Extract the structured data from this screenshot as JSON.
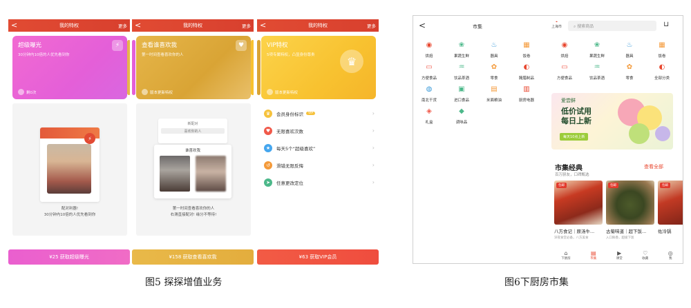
{
  "fig5": {
    "caption": "图5 探探增值业务",
    "screens": [
      {
        "back": "<",
        "title": "我的特权",
        "more": "更多",
        "card_title": "超级曝光",
        "card_sub": "30分钟内10倍的人优先看到你",
        "card_foot": "剩0次",
        "caption_line1": "配对利器!",
        "caption_line2": "30分钟内10倍的人优先看到你",
        "cta": "¥25 获取超级曝光"
      },
      {
        "back": "<",
        "title": "我的特权",
        "more": "更多",
        "card_title": "查看谁喜欢我",
        "card_sub": "第一时间查看喜欢你的人",
        "card_foot": "版本更新特权",
        "mini_title": "新配对",
        "mini_sub": "喜欢你的人",
        "likes_title": "谁喜欢我",
        "caption_line1": "第一时间查看喜欢你的人",
        "caption_line2": "右滑直接配对! 缘分不等待!",
        "cta": "¥158 获取查看喜欢我"
      },
      {
        "back": "<",
        "title": "我的特权",
        "more": "更多",
        "card_title": "VIP特权",
        "card_sub": "5项专属特权，凸显身份尊贵",
        "card_foot": "版本更新特权",
        "perks": [
          {
            "label": "会员身份标识",
            "badge": "VIP"
          },
          {
            "label": "无限喜欢次数",
            "badge": ""
          },
          {
            "label": "每天5个“超级喜欢”",
            "badge": ""
          },
          {
            "label": "滑错无限反悔",
            "badge": ""
          },
          {
            "label": "任意更改定位",
            "badge": ""
          }
        ],
        "cta": "¥63 获取VIP会员"
      }
    ]
  },
  "fig6": {
    "caption": "图6下厨房市集",
    "header": {
      "back": "<",
      "title": "市集",
      "loc": "上海市",
      "search_placeholder": "搜索商品",
      "cart": "🛒"
    },
    "categories_left": [
      "烘焙",
      "果蔬生鲜",
      "器具",
      "饭卷",
      "方便食品",
      "饮品茶酒",
      "零食",
      "腌腊制品",
      "南北干货",
      "进口食品",
      "米面粮油",
      "厨房电器",
      "礼盒",
      "调味品"
    ],
    "categories_right": [
      "烘焙",
      "果蔬生鲜",
      "器具",
      "饭卷",
      "方便食品",
      "饮品茶酒",
      "零食",
      "全部分类"
    ],
    "banner": {
      "brand": "爱尝鲜",
      "line1": "低价试用",
      "line2": "每日上新",
      "button": "每天10点上新"
    },
    "section": {
      "title": "市集经典",
      "subtitle": "百万厨友，口碑甄选",
      "more": "查看全部"
    },
    "products": [
      {
        "name": "八方食记｜原汤牛...",
        "desc": "深夜食堂必备，八方美食",
        "tag": "包邮"
      },
      {
        "name": "古菊味道｜超下饭...",
        "desc": "入口鲜香，超级下饭",
        "tag": "包邮"
      },
      {
        "name": "佐冷锅",
        "desc": "",
        "tag": "包邮"
      }
    ],
    "tabs": [
      {
        "label": "下厨房",
        "icon": "⌂",
        "active": false
      },
      {
        "label": "市集",
        "icon": "▤",
        "active": true
      },
      {
        "label": "课堂",
        "icon": "▶",
        "active": false
      },
      {
        "label": "收藏",
        "icon": "♡",
        "active": false
      },
      {
        "label": "我",
        "icon": "◎",
        "active": false
      }
    ]
  },
  "colors": {
    "accent_red": "#e8472f",
    "pink": "#e45fd8",
    "gold": "#d9a435",
    "yellow": "#f8c230"
  }
}
